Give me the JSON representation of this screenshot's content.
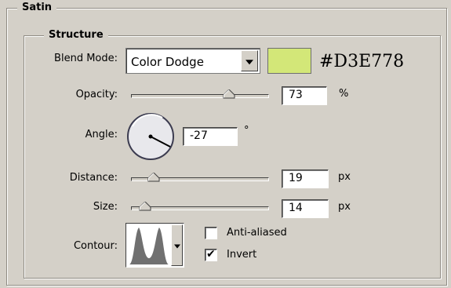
{
  "panel": {
    "title": "Satin"
  },
  "structure": {
    "title": "Structure",
    "blend_mode": {
      "label": "Blend Mode:",
      "value": "Color Dodge"
    },
    "color": {
      "swatch_color": "#D3E778",
      "hex_label": "#D3E778"
    },
    "opacity": {
      "label": "Opacity:",
      "value": "73",
      "unit": "%",
      "level_percent": 73
    },
    "angle": {
      "label": "Angle:",
      "value": "-27",
      "unit": "°"
    },
    "distance": {
      "label": "Distance:",
      "value": "19",
      "unit": "px"
    },
    "size": {
      "label": "Size:",
      "value": "14",
      "unit": "px"
    },
    "contour": {
      "label": "Contour:"
    },
    "anti_aliased": {
      "label": "Anti-aliased",
      "checked": false
    },
    "invert": {
      "label": "Invert",
      "checked": true,
      "mark": "✔"
    }
  }
}
